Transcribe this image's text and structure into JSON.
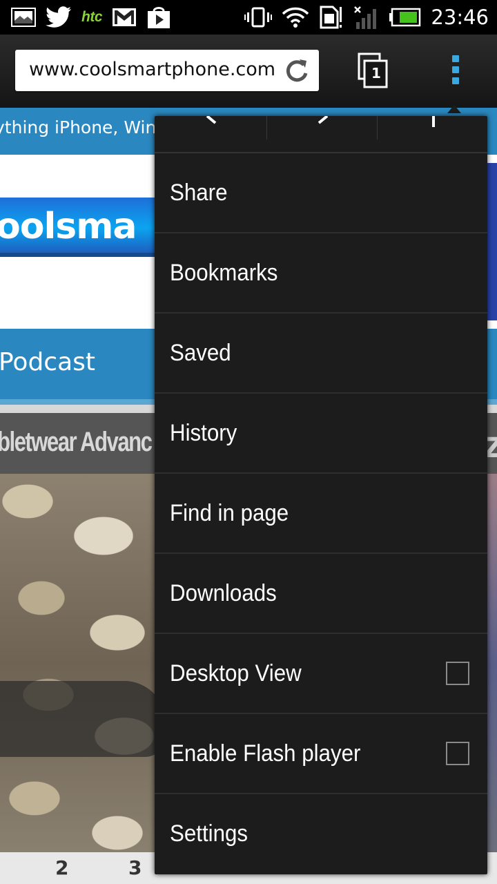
{
  "status_bar": {
    "time": "23:46",
    "carrier_logo": "htc",
    "left_icons": [
      "gallery-icon",
      "twitter-icon",
      "htc-logo",
      "gmail-icon",
      "play-store-icon"
    ],
    "right_icons": [
      "vibrate-icon",
      "wifi-icon",
      "sim-icon",
      "signal-icon",
      "battery-icon"
    ]
  },
  "toolbar": {
    "url": "www.coolsmartphone.com",
    "tab_count": "1"
  },
  "webpage": {
    "tagline": "ything iPhone, Winc",
    "logo_text": "oolsma",
    "nav_item": "Podcast",
    "article_title": "bletwear Advanc",
    "article_title_right": "Z",
    "pager": [
      "2",
      "3"
    ]
  },
  "menu": {
    "items": [
      {
        "label": "Share",
        "has_checkbox": false
      },
      {
        "label": "Bookmarks",
        "has_checkbox": false
      },
      {
        "label": "Saved",
        "has_checkbox": false
      },
      {
        "label": "History",
        "has_checkbox": false
      },
      {
        "label": "Find in page",
        "has_checkbox": false
      },
      {
        "label": "Downloads",
        "has_checkbox": false
      },
      {
        "label": "Desktop View",
        "has_checkbox": true,
        "checked": false
      },
      {
        "label": "Enable Flash player",
        "has_checkbox": true,
        "checked": false
      },
      {
        "label": "Settings",
        "has_checkbox": false
      }
    ]
  },
  "colors": {
    "accent": "#3aa9e1",
    "site_blue": "#2a87bf",
    "menu_bg": "#1c1c1c",
    "htc_green": "#8bd13a"
  }
}
